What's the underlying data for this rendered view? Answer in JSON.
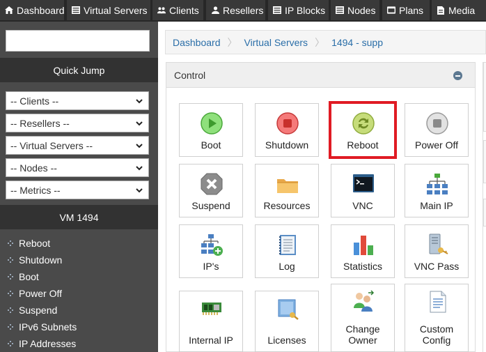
{
  "topnav": {
    "tabs": [
      {
        "label": "Dashboard",
        "icon": "home-icon"
      },
      {
        "label": "Virtual Servers",
        "icon": "server-icon"
      },
      {
        "label": "Clients",
        "icon": "users-icon"
      },
      {
        "label": "Resellers",
        "icon": "user-icon"
      },
      {
        "label": "IP Blocks",
        "icon": "ip-blocks-icon"
      },
      {
        "label": "Nodes",
        "icon": "nodes-icon"
      },
      {
        "label": "Plans",
        "icon": "plans-icon"
      },
      {
        "label": "Media",
        "icon": "media-icon"
      }
    ]
  },
  "sidebar": {
    "quick_jump_title": "Quick Jump",
    "selects": [
      "-- Clients --",
      "-- Resellers --",
      "-- Virtual Servers --",
      "-- Nodes --",
      "-- Metrics --"
    ],
    "vm_title": "VM 1494",
    "items": [
      "Reboot",
      "Shutdown",
      "Boot",
      "Power Off",
      "Suspend",
      "IPv6 Subnets",
      "IP Addresses"
    ]
  },
  "breadcrumb": [
    "Dashboard",
    "Virtual Servers",
    "1494 - supp"
  ],
  "panel": {
    "title": "Control",
    "tiles": [
      {
        "label": "Boot",
        "icon": "boot-icon"
      },
      {
        "label": "Shutdown",
        "icon": "shutdown-icon"
      },
      {
        "label": "Reboot",
        "icon": "reboot-icon",
        "highlighted": true
      },
      {
        "label": "Power Off",
        "icon": "power-off-icon"
      },
      {
        "label": "Suspend",
        "icon": "suspend-icon"
      },
      {
        "label": "Resources",
        "icon": "resources-icon"
      },
      {
        "label": "VNC",
        "icon": "vnc-icon"
      },
      {
        "label": "Main IP",
        "icon": "main-ip-icon"
      },
      {
        "label": "IP's",
        "icon": "ips-icon"
      },
      {
        "label": "Log",
        "icon": "log-icon"
      },
      {
        "label": "Statistics",
        "icon": "statistics-icon"
      },
      {
        "label": "VNC Pass",
        "icon": "vnc-pass-icon"
      },
      {
        "label": "Internal IP",
        "icon": "internal-ip-icon"
      },
      {
        "label": "Licenses",
        "icon": "licenses-icon"
      },
      {
        "label": "Change Owner",
        "icon": "change-owner-icon"
      },
      {
        "label": "Custom Config",
        "icon": "custom-config-icon"
      }
    ]
  },
  "colors": {
    "highlight": "#e01b24",
    "link": "#2a6ea8",
    "nav_bg": "#272727",
    "sidebar_bg": "#4a4a4a"
  }
}
